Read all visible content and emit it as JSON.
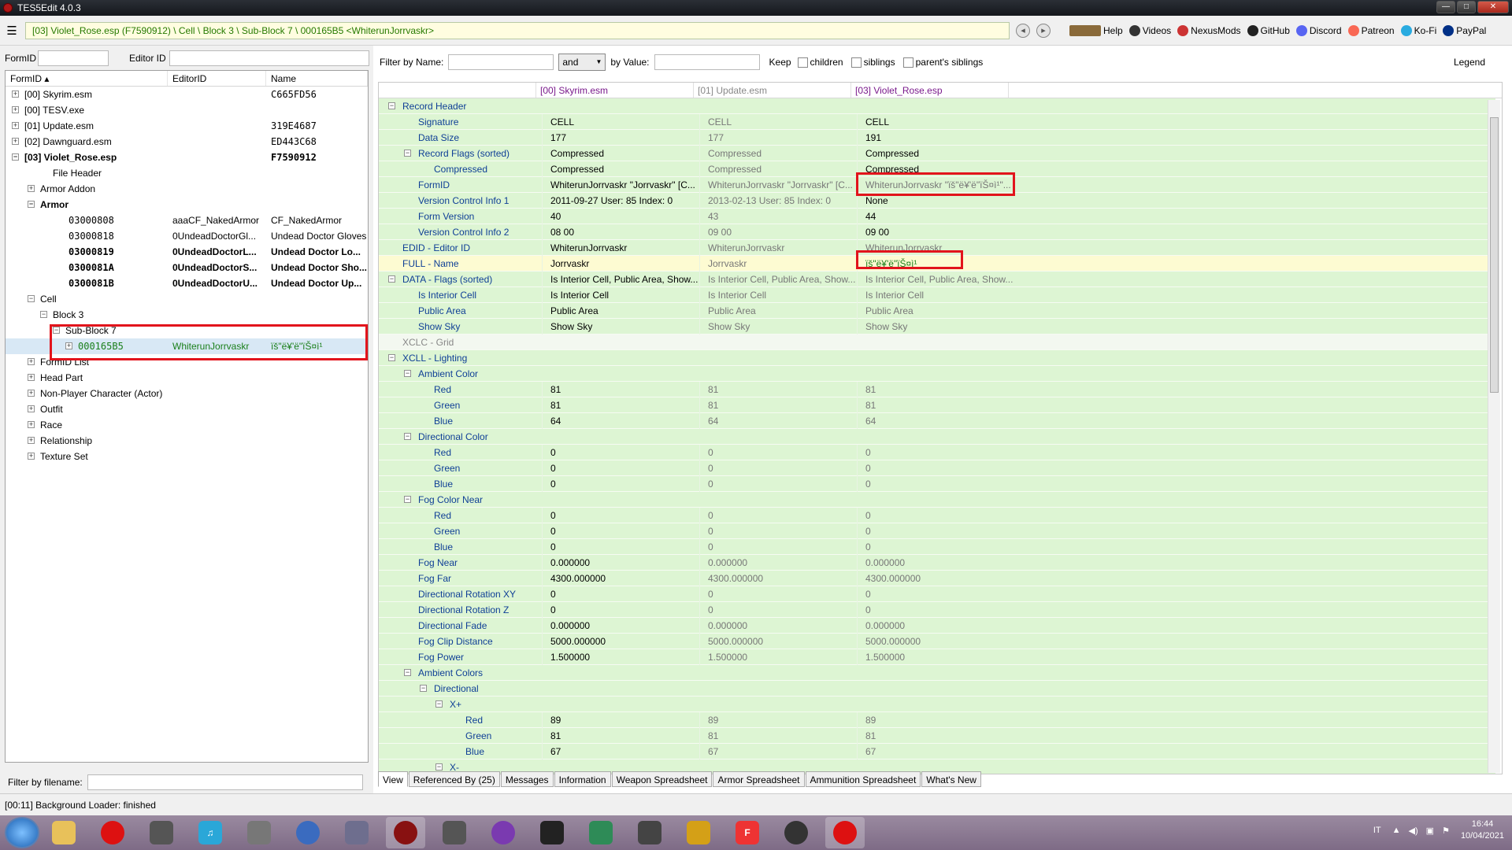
{
  "window": {
    "title": "TES5Edit 4.0.3"
  },
  "toolbar": {
    "path": "[03] Violet_Rose.esp (F7590912) \\ Cell \\ Block 3 \\ Sub-Block 7 \\ 000165B5 <WhiterunJorrvaskr>",
    "links": [
      "Help",
      "Videos",
      "NexusMods",
      "GitHub",
      "Discord",
      "Patreon",
      "Ko-Fi",
      "PayPal"
    ]
  },
  "left": {
    "formid_label": "FormID",
    "editorid_label": "Editor ID",
    "headers": [
      "FormID",
      "EditorID",
      "Name"
    ],
    "filter_filename_label": "Filter by filename:",
    "tree": [
      {
        "c1": "[00] Skyrim.esm",
        "c2": "",
        "c3": "C665FD56"
      },
      {
        "c1": "[00] TESV.exe",
        "c2": "",
        "c3": ""
      },
      {
        "c1": "[01] Update.esm",
        "c2": "",
        "c3": "319E4687"
      },
      {
        "c1": "[02] Dawnguard.esm",
        "c2": "",
        "c3": "ED443C68"
      },
      {
        "c1": "[03] Violet_Rose.esp",
        "c2": "",
        "c3": "F7590912"
      },
      {
        "c1": "File Header",
        "c2": "",
        "c3": ""
      },
      {
        "c1": "Armor Addon",
        "c2": "",
        "c3": ""
      },
      {
        "c1": "Armor",
        "c2": "",
        "c3": ""
      },
      {
        "c1": "03000808",
        "c2": "aaaCF_NakedArmor",
        "c3": "CF_NakedArmor"
      },
      {
        "c1": "03000818",
        "c2": "0UndeadDoctorGl...",
        "c3": "Undead Doctor Gloves"
      },
      {
        "c1": "03000819",
        "c2": "0UndeadDoctorL...",
        "c3": "Undead Doctor Lo..."
      },
      {
        "c1": "0300081A",
        "c2": "0UndeadDoctorS...",
        "c3": "Undead Doctor Sho..."
      },
      {
        "c1": "0300081B",
        "c2": "0UndeadDoctorU...",
        "c3": "Undead Doctor Up..."
      },
      {
        "c1": "Cell",
        "c2": "",
        "c3": ""
      },
      {
        "c1": "Block 3",
        "c2": "",
        "c3": ""
      },
      {
        "c1": "Sub-Block 7",
        "c2": "",
        "c3": ""
      },
      {
        "c1": "000165B5",
        "c2": "WhiterunJorrvaskr",
        "c3": "ïš\"ë¥'ë\"ïŠ¤ì¹"
      },
      {
        "c1": "FormID List",
        "c2": "",
        "c3": ""
      },
      {
        "c1": "Head Part",
        "c2": "",
        "c3": ""
      },
      {
        "c1": "Non-Player Character (Actor)",
        "c2": "",
        "c3": ""
      },
      {
        "c1": "Outfit",
        "c2": "",
        "c3": ""
      },
      {
        "c1": "Race",
        "c2": "",
        "c3": ""
      },
      {
        "c1": "Relationship",
        "c2": "",
        "c3": ""
      },
      {
        "c1": "Texture Set",
        "c2": "",
        "c3": ""
      }
    ]
  },
  "right": {
    "filter": {
      "by_name": "Filter by Name:",
      "and": "and",
      "by_value": "by Value:",
      "keep": "Keep",
      "children": "children",
      "siblings": "siblings",
      "parents_siblings": "parent's siblings",
      "legend": "Legend"
    },
    "columns": [
      "",
      "[00] Skyrim.esm",
      "[01] Update.esm",
      "[03] Violet_Rose.esp"
    ],
    "rows": [
      {
        "label": "Record Header",
        "v": [
          "",
          "",
          ""
        ]
      },
      {
        "label": "Signature",
        "v": [
          "CELL",
          "CELL",
          "CELL"
        ]
      },
      {
        "label": "Data Size",
        "v": [
          "177",
          "177",
          "191"
        ]
      },
      {
        "label": "Record Flags (sorted)",
        "v": [
          "Compressed",
          "Compressed",
          "Compressed"
        ]
      },
      {
        "label": "Compressed",
        "v": [
          "Compressed",
          "Compressed",
          "Compressed"
        ]
      },
      {
        "label": "FormID",
        "v": [
          "WhiterunJorrvaskr \"Jorrvaskr\" [C...",
          "WhiterunJorrvaskr \"Jorrvaskr\" [C...",
          "WhiterunJorrvaskr \"ïš\"ë¥'ë\"ïŠ¤ì¹\"..."
        ]
      },
      {
        "label": "Version Control Info 1",
        "v": [
          "2011-09-27 User: 85 Index: 0",
          "2013-02-13 User: 85 Index: 0",
          "None"
        ]
      },
      {
        "label": "Form Version",
        "v": [
          "40",
          "43",
          "44"
        ]
      },
      {
        "label": "Version Control Info 2",
        "v": [
          "08 00",
          "09 00",
          "09 00"
        ]
      },
      {
        "label": "EDID - Editor ID",
        "v": [
          "WhiterunJorrvaskr",
          "WhiterunJorrvaskr",
          "WhiterunJorrvaskr"
        ]
      },
      {
        "label": "FULL - Name",
        "v": [
          "Jorrvaskr",
          "Jorrvaskr",
          "ïš\"ë¥'ë\"ïŠ¤ì¹"
        ]
      },
      {
        "label": "DATA - Flags (sorted)",
        "v": [
          "Is Interior Cell, Public Area, Show...",
          "Is Interior Cell, Public Area, Show...",
          "Is Interior Cell, Public Area, Show..."
        ]
      },
      {
        "label": "Is Interior Cell",
        "v": [
          "Is Interior Cell",
          "Is Interior Cell",
          "Is Interior Cell"
        ]
      },
      {
        "label": "Public Area",
        "v": [
          "Public Area",
          "Public Area",
          "Public Area"
        ]
      },
      {
        "label": "Show Sky",
        "v": [
          "Show Sky",
          "Show Sky",
          "Show Sky"
        ]
      },
      {
        "label": "XCLC - Grid",
        "v": [
          "",
          "",
          ""
        ]
      },
      {
        "label": "XCLL - Lighting",
        "v": [
          "",
          "",
          ""
        ]
      },
      {
        "label": "Ambient Color",
        "v": [
          "",
          "",
          ""
        ]
      },
      {
        "label": "Red",
        "v": [
          "81",
          "81",
          "81"
        ]
      },
      {
        "label": "Green",
        "v": [
          "81",
          "81",
          "81"
        ]
      },
      {
        "label": "Blue",
        "v": [
          "64",
          "64",
          "64"
        ]
      },
      {
        "label": "Directional Color",
        "v": [
          "",
          "",
          ""
        ]
      },
      {
        "label": "Red",
        "v": [
          "0",
          "0",
          "0"
        ]
      },
      {
        "label": "Green",
        "v": [
          "0",
          "0",
          "0"
        ]
      },
      {
        "label": "Blue",
        "v": [
          "0",
          "0",
          "0"
        ]
      },
      {
        "label": "Fog Color Near",
        "v": [
          "",
          "",
          ""
        ]
      },
      {
        "label": "Red",
        "v": [
          "0",
          "0",
          "0"
        ]
      },
      {
        "label": "Green",
        "v": [
          "0",
          "0",
          "0"
        ]
      },
      {
        "label": "Blue",
        "v": [
          "0",
          "0",
          "0"
        ]
      },
      {
        "label": "Fog Near",
        "v": [
          "0.000000",
          "0.000000",
          "0.000000"
        ]
      },
      {
        "label": "Fog Far",
        "v": [
          "4300.000000",
          "4300.000000",
          "4300.000000"
        ]
      },
      {
        "label": "Directional Rotation XY",
        "v": [
          "0",
          "0",
          "0"
        ]
      },
      {
        "label": "Directional Rotation Z",
        "v": [
          "0",
          "0",
          "0"
        ]
      },
      {
        "label": "Directional Fade",
        "v": [
          "0.000000",
          "0.000000",
          "0.000000"
        ]
      },
      {
        "label": "Fog Clip Distance",
        "v": [
          "5000.000000",
          "5000.000000",
          "5000.000000"
        ]
      },
      {
        "label": "Fog Power",
        "v": [
          "1.500000",
          "1.500000",
          "1.500000"
        ]
      },
      {
        "label": "Ambient Colors",
        "v": [
          "",
          "",
          ""
        ]
      },
      {
        "label": "Directional",
        "v": [
          "",
          "",
          ""
        ]
      },
      {
        "label": "X+",
        "v": [
          "",
          "",
          ""
        ]
      },
      {
        "label": "Red",
        "v": [
          "89",
          "89",
          "89"
        ]
      },
      {
        "label": "Green",
        "v": [
          "81",
          "81",
          "81"
        ]
      },
      {
        "label": "Blue",
        "v": [
          "67",
          "67",
          "67"
        ]
      },
      {
        "label": "X-",
        "v": [
          "",
          "",
          ""
        ]
      }
    ],
    "tabs": [
      "View",
      "Referenced By (25)",
      "Messages",
      "Information",
      "Weapon Spreadsheet",
      "Armor Spreadsheet",
      "Ammunition Spreadsheet",
      "What's New"
    ]
  },
  "status": {
    "text": "[00:11] Background Loader: finished"
  },
  "taskbar": {
    "lang": "IT",
    "time": "16:44",
    "date": "10/04/2021"
  },
  "colors": {
    "row_green": "#ddf5d3",
    "row_yellow": "#fdfbd2",
    "label_blue": "#0f3f96",
    "path_green": "#267a00",
    "highlight_red": "#e2141c"
  }
}
